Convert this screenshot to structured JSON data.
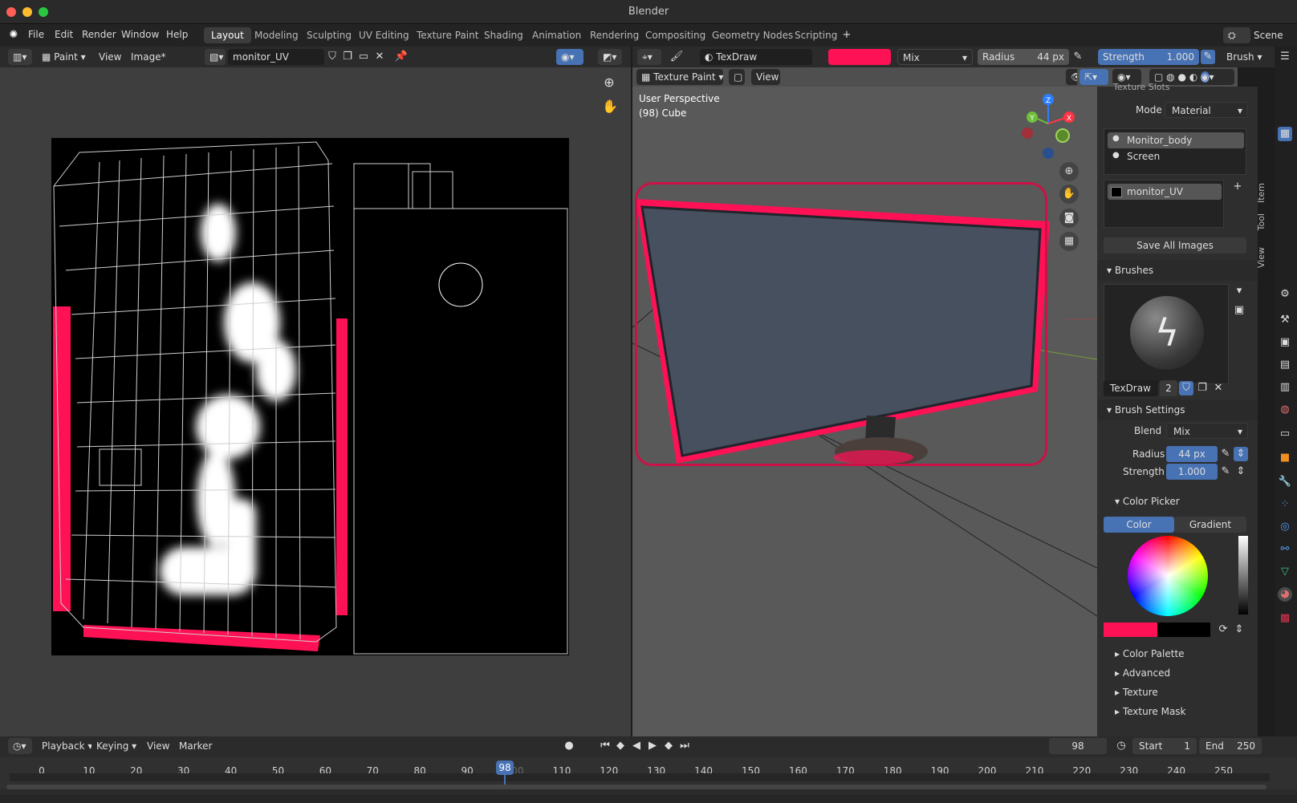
{
  "window": {
    "title": "Blender"
  },
  "menu": {
    "items": [
      "File",
      "Edit",
      "Render",
      "Window",
      "Help"
    ]
  },
  "workspaces": [
    "Layout",
    "Modeling",
    "Sculpting",
    "UV Editing",
    "Texture Paint",
    "Shading",
    "Animation",
    "Rendering",
    "Compositing",
    "Geometry Nodes",
    "Scripting"
  ],
  "active_workspace": "Layout",
  "scene": "Scene",
  "image_editor": {
    "mode": "Paint",
    "view": "View",
    "image_menu": "Image*",
    "image_name": "monitor_UV"
  },
  "viewport_header": {
    "brush_name": "TexDraw",
    "blend": "Mix",
    "radius_label": "Radius",
    "radius_value": "44 px",
    "strength_label": "Strength",
    "strength_value": "1.000",
    "brush_menu": "Brush",
    "mode": "Texture Paint",
    "view": "View",
    "overlay_line1": "User Perspective",
    "overlay_line2": "(98) Cube",
    "paint_color": "#ff1155"
  },
  "gizmo": {
    "z": "Z",
    "y": "Y",
    "x": "X"
  },
  "npanel": {
    "texture_slots_title": "Texture Slots",
    "mode_label": "Mode",
    "mode_value": "Material",
    "materials": [
      "Monitor_body",
      "Screen"
    ],
    "image_slot": "monitor_UV",
    "save_all": "Save All Images",
    "brushes_title": "Brushes",
    "brush_name": "TexDraw",
    "brush_users": "2",
    "brush_settings_title": "Brush Settings",
    "blend_label": "Blend",
    "blend_value": "Mix",
    "radius_label": "Radius",
    "radius_value": "44 px",
    "strength_label": "Strength",
    "strength_value": "1.000",
    "color_picker_title": "Color Picker",
    "color_tab": "Color",
    "gradient_tab": "Gradient",
    "collapsed": [
      "Color Palette",
      "Advanced",
      "Texture",
      "Texture Mask"
    ],
    "side_tabs": [
      "Item",
      "Tool",
      "View"
    ]
  },
  "timeline": {
    "playback": "Playback",
    "keying": "Keying",
    "view": "View",
    "marker": "Marker",
    "current_frame": "98",
    "start_label": "Start",
    "start_value": "1",
    "end_label": "End",
    "end_value": "250",
    "ticks": [
      "0",
      "10",
      "20",
      "30",
      "40",
      "50",
      "60",
      "70",
      "80",
      "90",
      "100",
      "110",
      "120",
      "130",
      "140",
      "150",
      "160",
      "170",
      "180",
      "190",
      "200",
      "210",
      "220",
      "230",
      "240",
      "250"
    ]
  },
  "colors": {
    "accent": "#4772b3",
    "highlight": "#cc1148",
    "paint": "#ff1155"
  }
}
